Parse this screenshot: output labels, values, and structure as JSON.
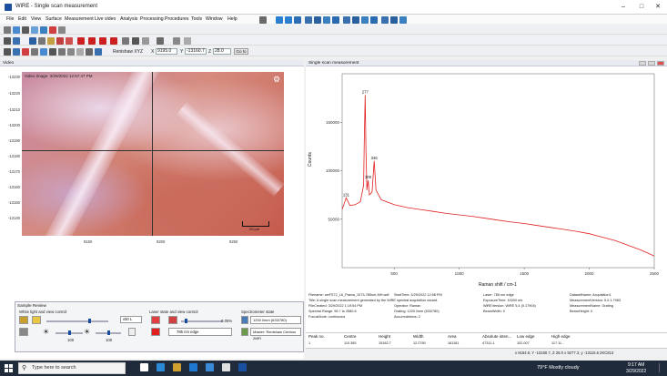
{
  "window": {
    "title": "WiRE - Single scan measurement"
  },
  "menu": [
    "File",
    "Edit",
    "View",
    "Surface",
    "Measurement",
    "Live video",
    "Analysis",
    "Processing",
    "Procedures",
    "Tools",
    "Window",
    "Help"
  ],
  "coords": {
    "stage_label": "Renishaw XYZ",
    "x_label": "X",
    "x_value": "9195.0",
    "y_label": "Y",
    "y_value": "-13160.7",
    "z_label": "Z",
    "z_value": "28.0",
    "goto_label": "Go to"
  },
  "video_panel": {
    "title": "Video",
    "image_label": "Video Image: 3/29/2022 12:57:47 PM",
    "scale_text": "20 μm",
    "y_ticks": [
      "-13230",
      "-13220",
      "-13210",
      "-13200",
      "-13190",
      "-13180",
      "-13170",
      "-13160",
      "-13150",
      "-13140"
    ],
    "x_ticks": [
      "9150",
      "9200",
      "9250"
    ]
  },
  "sample_review": {
    "title": "Sample Review",
    "white_light_label": "White light and view control",
    "laser_label": "Laser state and view control",
    "spectrometer_label": "Spectrometer state",
    "zoom_value": "x50 L",
    "slider_a": "100",
    "slider_b": "100",
    "laser_power": "0.05%",
    "laser_name": "785 nm edge",
    "grating": "1200 l/mm (633/780)",
    "detector": "Master: Renishaw Centrus 2MFI"
  },
  "spectrum_panel": {
    "title": "Single scan measurement",
    "xlabel": "Raman shift / cm-1",
    "ylabel": "Counts",
    "peak_labels": [
      "277",
      "300",
      "346",
      "131"
    ]
  },
  "chart_data": {
    "type": "line",
    "title": "",
    "xlabel": "Raman shift / cm-1",
    "ylabel": "Counts",
    "xlim": [
      100,
      2500
    ],
    "ylim": [
      0,
      200000
    ],
    "x_ticks": [
      500,
      1000,
      1500,
      2000,
      2500
    ],
    "y_ticks": [
      50000,
      100000,
      150000
    ],
    "series": [
      {
        "color": "#e02020",
        "x": [
          100,
          131,
          160,
          200,
          240,
          265,
          270,
          277,
          283,
          290,
          300,
          310,
          330,
          346,
          360,
          400,
          500,
          600,
          700,
          800,
          900,
          1000,
          1100,
          1200,
          1300,
          1400,
          1500,
          1600,
          1700,
          1800,
          1900,
          2000,
          2100,
          2200,
          2300,
          2400,
          2500
        ],
        "y": [
          60000,
          72000,
          64000,
          65000,
          68000,
          85000,
          130000,
          178000,
          120000,
          80000,
          90000,
          75000,
          78000,
          110000,
          80000,
          70000,
          65000,
          62000,
          60000,
          58000,
          56000,
          54500,
          53000,
          51000,
          49000,
          47000,
          45500,
          43500,
          41500,
          39500,
          37500,
          35000,
          31500,
          28000,
          23000,
          18000,
          12000
        ]
      }
    ]
  },
  "measurement_info": [
    "Filename: weFS72_L6_Pasna_1073-785nm-MH.wdf",
    "Title: A single scan measurement generated by the WiRE spectral acquisition wizard.",
    "FileCreated: 3/29/2022 1:19:54 PM",
    "Spectral Range: 96.7 to 2580.6",
    "FocusMode: continuous",
    "StartTime: 3/29/2022 12:58 PM",
    "Laser: 785 nm edge",
    "ExposureTime: 10000 ms",
    "Operator: Raman",
    "WiREVersion: WiRE 5.4 (0.17904)",
    "Grating: 1200 l/mm (633/780)",
    "BeamWidth: 0",
    "Accumulations: 2",
    "DatasetName: Acquisition1",
    "MeasurementVersion: 5.0.1.7983",
    "MeasurementName: Grating",
    "BeamHeight: 0"
  ],
  "peak_table": {
    "headers": [
      "Peak no.",
      "Centre",
      "Height",
      "Width",
      "Area",
      "Absolute inten...",
      "Low edge",
      "High edge"
    ],
    "row": [
      "1",
      "110.365",
      "15182.7",
      "12.2780",
      "161181",
      "47311.1",
      "102.007",
      "117.11..."
    ]
  },
  "statusbar": {
    "text": "x 9164.8, Y -13160.7, Z 28.0  x 9277.3, y -13115.6  2KC813"
  },
  "taskbar": {
    "search_placeholder": "Type here to search",
    "weather": "79°F  Mostly cloudy",
    "time": "9:17 AM",
    "date": "3/29/2022"
  }
}
